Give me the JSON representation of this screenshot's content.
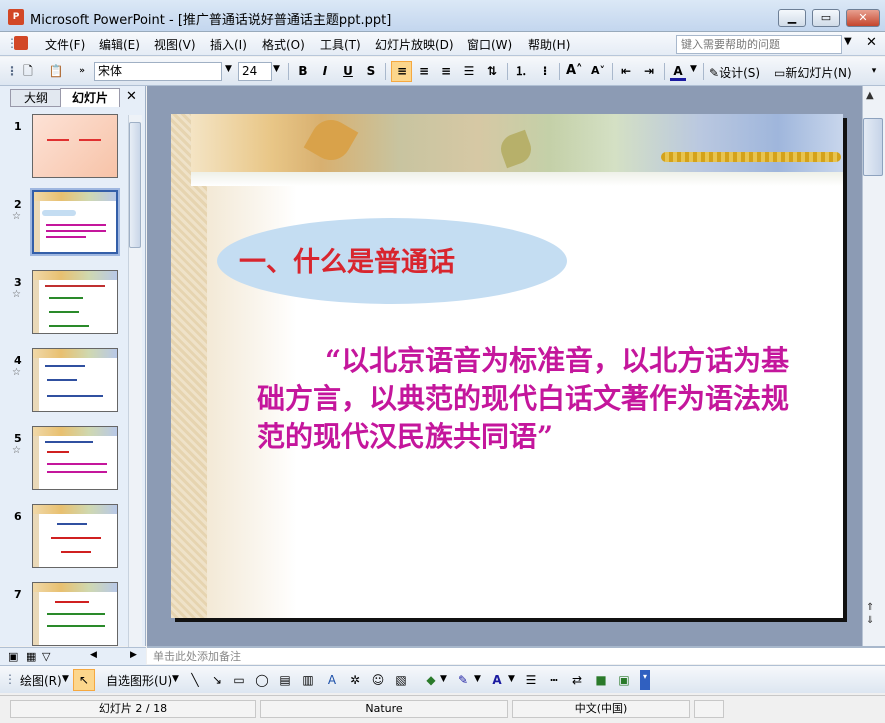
{
  "window": {
    "title": "Microsoft PowerPoint - [推广普通话说好普通话主题ppt.ppt]",
    "app_icon_label": "P"
  },
  "menu": {
    "items": [
      "文件(F)",
      "编辑(E)",
      "视图(V)",
      "插入(I)",
      "格式(O)",
      "工具(T)",
      "幻灯片放映(D)",
      "窗口(W)",
      "帮助(H)"
    ],
    "help_placeholder": "键入需要帮助的问题"
  },
  "toolbar": {
    "font_name": "宋体",
    "font_size": "24",
    "design_label": "设计(S)",
    "new_slide_label": "新幻灯片(N)"
  },
  "left_pane": {
    "tabs": [
      "大纲",
      "幻灯片"
    ],
    "active_tab": "幻灯片",
    "slides": [
      {
        "number": "1",
        "has_star": false
      },
      {
        "number": "2",
        "has_star": true,
        "selected": true
      },
      {
        "number": "3",
        "has_star": true
      },
      {
        "number": "4",
        "has_star": true
      },
      {
        "number": "5",
        "has_star": true
      },
      {
        "number": "6",
        "has_star": false
      },
      {
        "number": "7",
        "has_star": false
      }
    ]
  },
  "slide": {
    "heading": "一、什么是普通话",
    "body": "“以北京语音为标准音，以北方话为基础方言，以典范的现代白话文著作为语法规范的现代汉民族共同语”",
    "heading_color": "#d8252e",
    "body_color": "#c4169c",
    "oval_color": "#c4ddf2"
  },
  "notes": {
    "text": "单击此处添加备注"
  },
  "drawing_toolbar": {
    "draw_label": "绘图(R)",
    "autoshapes_label": "自选图形(U)"
  },
  "status": {
    "slide_position": "幻灯片 2 / 18",
    "design": "Nature",
    "language": "中文(中国)"
  }
}
